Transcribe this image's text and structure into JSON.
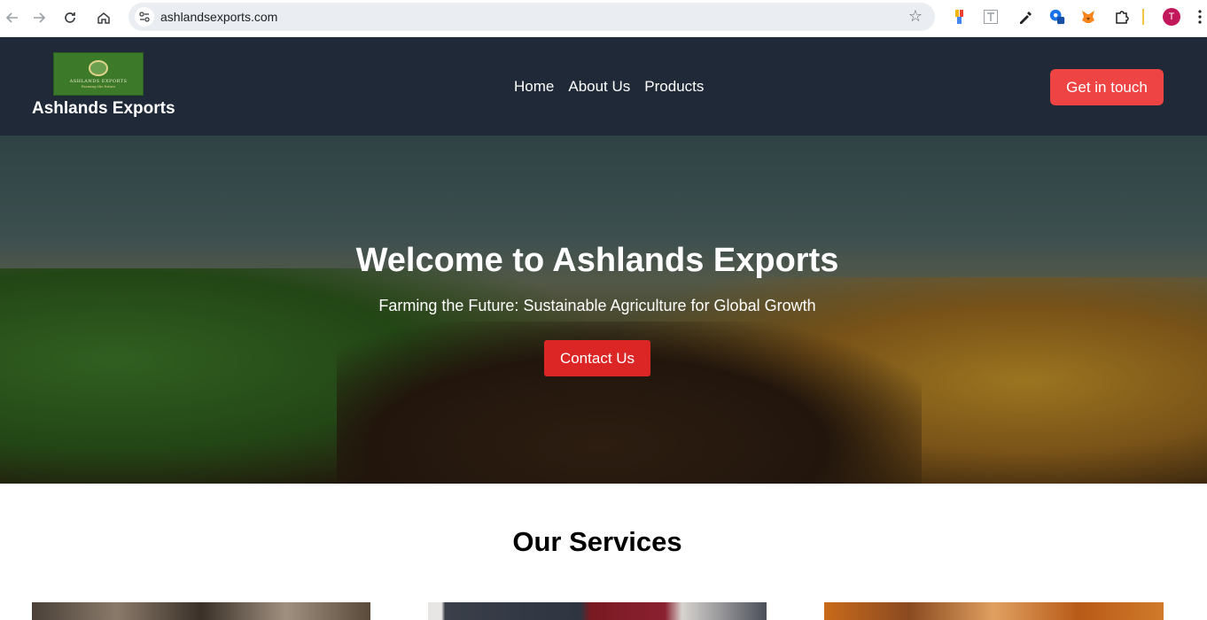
{
  "browser": {
    "url": "ashlandsexports.com",
    "profile_initial": "T"
  },
  "header": {
    "logo_text": "ASHLANDS EXPORTS",
    "logo_tagline": "Farming the future",
    "brand_name": "Ashlands Exports",
    "nav": [
      {
        "label": "Home"
      },
      {
        "label": "About Us"
      },
      {
        "label": "Products"
      }
    ],
    "cta_label": "Get in touch"
  },
  "hero": {
    "title": "Welcome to Ashlands Exports",
    "subtitle": "Farming the Future: Sustainable Agriculture for Global Growth",
    "button_label": "Contact Us"
  },
  "services": {
    "title": "Our Services"
  },
  "colors": {
    "header_bg": "#1f2937",
    "accent_red": "#ef4444",
    "hero_button": "#dc2626",
    "logo_green": "#3c7a2a"
  }
}
